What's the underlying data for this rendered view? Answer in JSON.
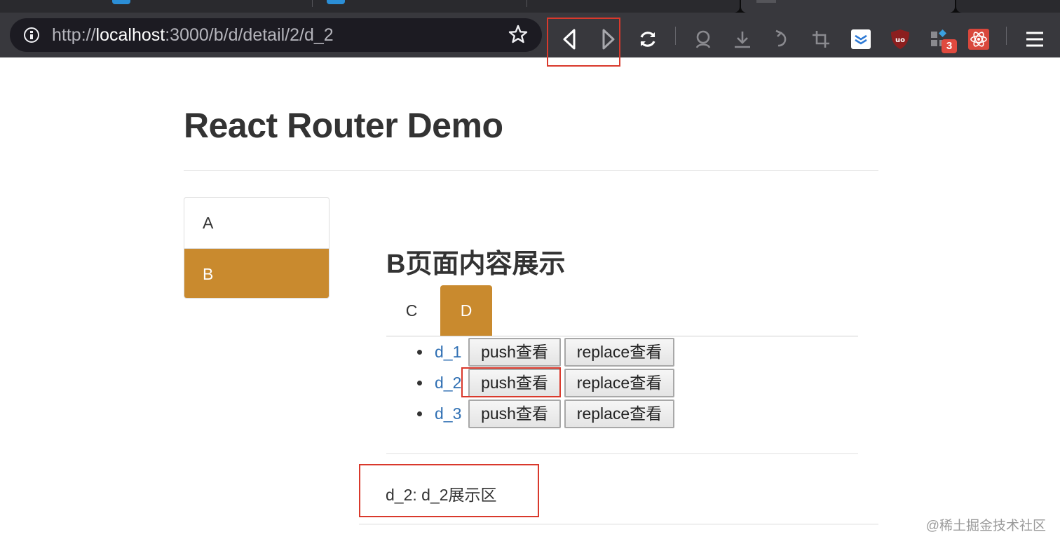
{
  "browser": {
    "url": {
      "scheme": "http://",
      "host": "localhost",
      "rest": ":3000/b/d/detail/2/d_2"
    },
    "toolbar_icons": [
      "back-icon",
      "forward-icon",
      "reload-icon",
      "pocket-icon",
      "download-icon",
      "undo-icon",
      "crop-icon",
      "toggl-icon",
      "ublock-icon",
      "extensions-icon",
      "react-devtools-icon",
      "menu-icon"
    ],
    "extension_badge": "3",
    "colors": {
      "chrome": "#38383d",
      "urlbar": "#1c1b22",
      "highlight": "#d9392c"
    }
  },
  "page": {
    "title": "React Router Demo",
    "nav": [
      {
        "label": "A",
        "active": false
      },
      {
        "label": "B",
        "active": true
      }
    ],
    "section_title": "B页面内容展示",
    "subtabs": [
      {
        "label": "C",
        "active": false
      },
      {
        "label": "D",
        "active": true
      }
    ],
    "details": [
      {
        "link": "d_1",
        "push_label": "push查看",
        "replace_label": "replace查看"
      },
      {
        "link": "d_2",
        "push_label": "push查看",
        "replace_label": "replace查看"
      },
      {
        "link": "d_3",
        "push_label": "push查看",
        "replace_label": "replace查看"
      }
    ],
    "display_text": "d_2: d_2展示区",
    "accent_color": "#c98a2e",
    "link_color": "#2f6fb3"
  },
  "watermark": "@稀土掘金技术社区"
}
